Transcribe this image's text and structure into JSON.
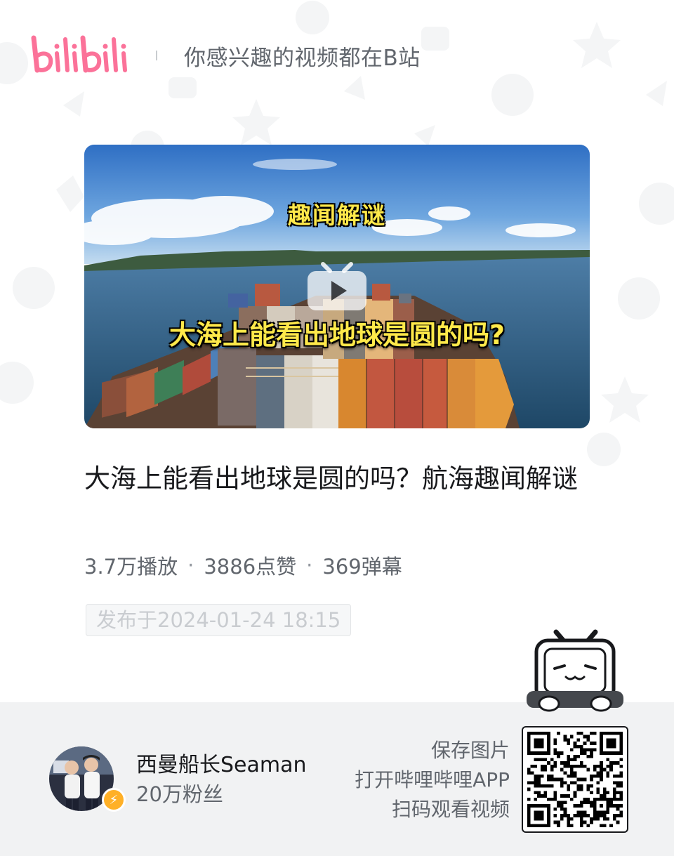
{
  "header": {
    "logo_text": "bilibili",
    "slogan": "你感兴趣的视频都在B站"
  },
  "video": {
    "cover_tag": "趣闻解谜",
    "cover_headline": "大海上能看出地球是圆的吗?",
    "title": "大海上能看出地球是圆的吗？航海趣闻解谜",
    "stats": {
      "views": "3.7万播放",
      "likes": "3886点赞",
      "danmaku": "369弹幕",
      "separator": "·"
    },
    "published": "发布于2024-01-24 18:15"
  },
  "author": {
    "name": "西曼船长Seaman",
    "fans": "20万粉丝",
    "badge_icon": "lightning-icon"
  },
  "cta": {
    "line1": "保存图片",
    "line2": "打开哔哩哔哩APP",
    "line3": "扫码观看视频"
  },
  "colors": {
    "brand_pink": "#fb7299",
    "badge_orange": "#ffb027",
    "headline_yellow": "#ffe94a"
  }
}
